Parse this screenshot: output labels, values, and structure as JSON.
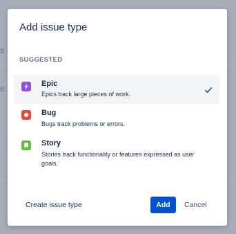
{
  "dialog": {
    "title": "Add issue type",
    "section_label": "SUGGESTED",
    "items": [
      {
        "name": "Epic",
        "description": "Epics track large pieces of work.",
        "icon": "epic-icon",
        "color": "#904ee2",
        "selected": true
      },
      {
        "name": "Bug",
        "description": "Bugs track problems or errors.",
        "icon": "bug-icon",
        "color": "#e5493a",
        "selected": false
      },
      {
        "name": "Story",
        "description": "Stories track functionality or features expressed as user goals.",
        "icon": "story-icon",
        "color": "#63ba3c",
        "selected": false
      }
    ],
    "footer": {
      "create_link": "Create issue type",
      "add_label": "Add",
      "cancel_label": "Cancel"
    }
  },
  "colors": {
    "primary": "#0052cc",
    "text": "#172b4d",
    "subtle_text": "#5e6c84",
    "selected_bg": "#f4f5f7"
  }
}
